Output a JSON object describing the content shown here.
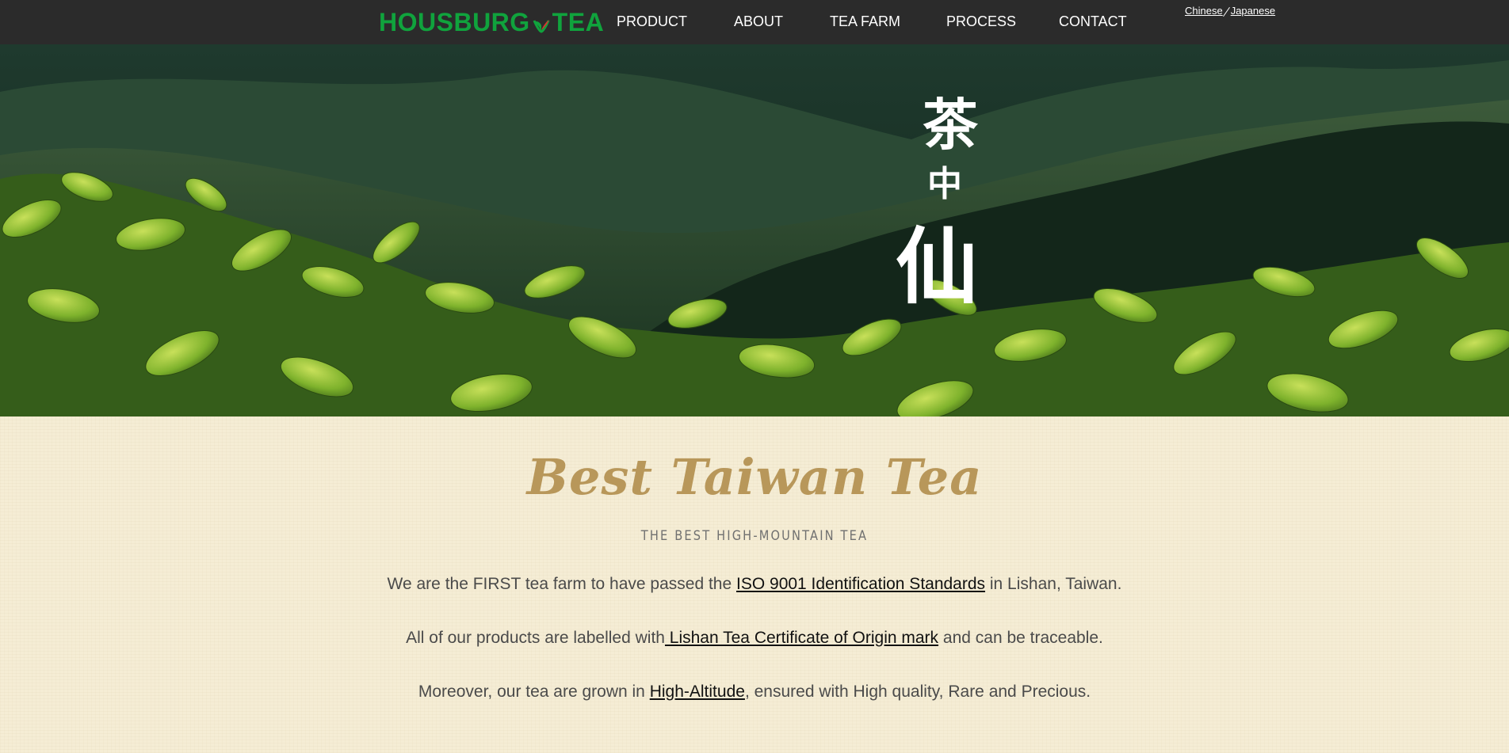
{
  "header": {
    "logo_left": "HOUSBURG",
    "logo_right": "TEA",
    "nav": [
      "PRODUCT",
      "ABOUT",
      "TEA FARM",
      "PROCESS",
      "CONTACT"
    ],
    "lang_chinese": "Chinese",
    "lang_japanese": "Japanese"
  },
  "hero": {
    "calligraphy": [
      "茶",
      "中",
      "仙"
    ]
  },
  "main": {
    "title": "Best Taiwan Tea",
    "subtitle": "THE BEST HIGH-MOUNTAIN TEA",
    "line1": {
      "before": "We are the FIRST tea farm to have passed the ",
      "link": "ISO 9001 Identification Standards",
      "after": " in Lishan, Taiwan."
    },
    "line2": {
      "before": "All of our products are labelled with",
      "link": " Lishan Tea Certificate of Origin mark",
      "after": " and can be traceable."
    },
    "line3": {
      "before": "Moreover, our tea are grown in ",
      "link": "High-Altitude",
      "after": ", ensured with High quality, Rare and Precious."
    }
  },
  "colors": {
    "header_bg": "#2b2b2b",
    "logo_green": "#10a33d",
    "title_gold": "#b8975a",
    "content_bg": "#f5edd5"
  }
}
